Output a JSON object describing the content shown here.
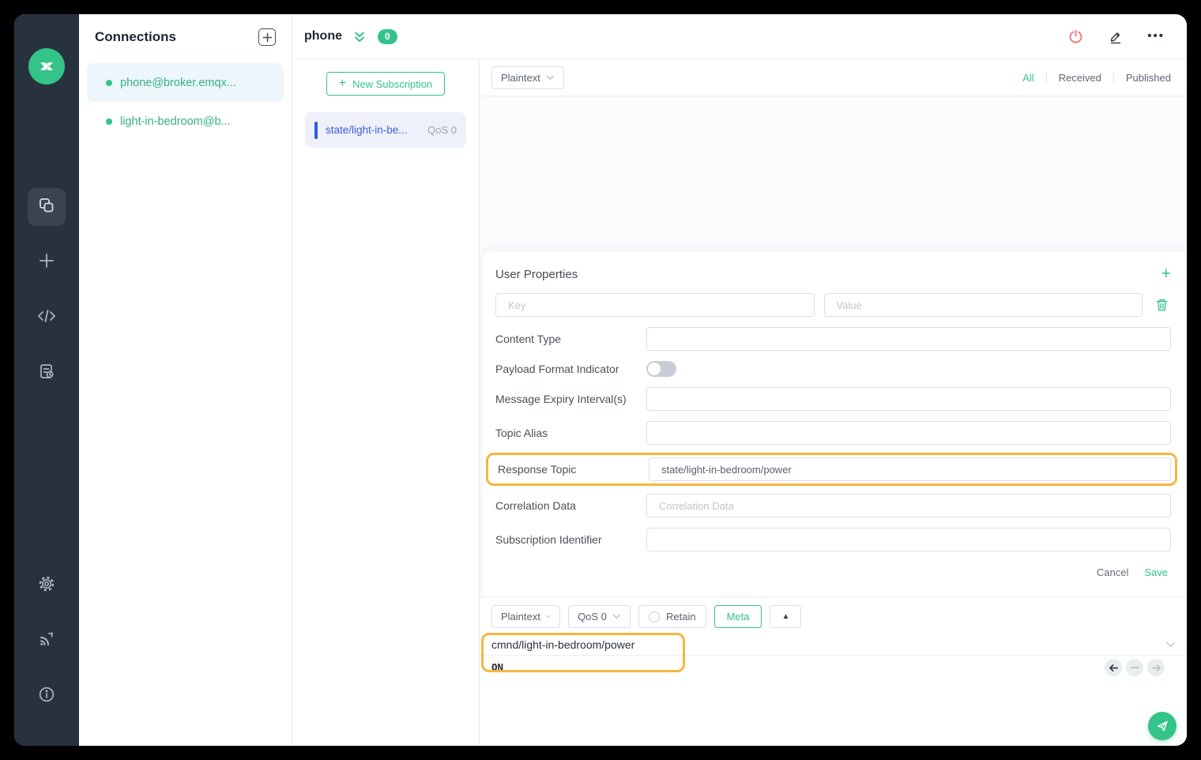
{
  "colors": {
    "brand_green": "#34c388",
    "sidebar_dark": "#28323e",
    "danger_red": "#f56c6c",
    "subscription_blue": "#3c60e4",
    "highlight_orange": "#f5b73d"
  },
  "connections": {
    "title": "Connections",
    "items": [
      {
        "name": "phone@broker.emqx...",
        "active": true
      },
      {
        "name": "light-in-bedroom@b...",
        "active": false
      }
    ]
  },
  "header": {
    "title": "phone",
    "badge_count": "0"
  },
  "subscriptions": {
    "new_button_label": "New Subscription",
    "items": [
      {
        "topic": "state/light-in-be...",
        "qos": "QoS 0"
      }
    ]
  },
  "messages": {
    "payload_format": "Plaintext",
    "tabs": [
      {
        "label": "All",
        "active": true
      },
      {
        "label": "Received",
        "active": false
      },
      {
        "label": "Published",
        "active": false
      }
    ]
  },
  "properties_form": {
    "title": "User Properties",
    "key_placeholder": "Key",
    "value_placeholder": "Value",
    "content_type_label": "Content Type",
    "payload_format_indicator_label": "Payload Format Indicator",
    "payload_format_indicator_state": "off",
    "message_expiry_label": "Message Expiry Interval(s)",
    "topic_alias_label": "Topic Alias",
    "response_topic_label": "Response Topic",
    "response_topic_value": "state/light-in-bedroom/power",
    "correlation_label": "Correlation Data",
    "correlation_placeholder": "Correlation Data",
    "subscription_identifier_label": "Subscription Identifier",
    "cancel_label": "Cancel",
    "save_label": "Save"
  },
  "publish": {
    "payload_format": "Plaintext",
    "qos": "QoS 0",
    "retain_label": "Retain",
    "retain_checked": false,
    "meta_label": "Meta",
    "topic": "cmnd/light-in-bedroom/power",
    "payload": "ON"
  },
  "icons": {
    "ellipsis": "•••",
    "triangle_up": "▲",
    "plus": "+"
  }
}
